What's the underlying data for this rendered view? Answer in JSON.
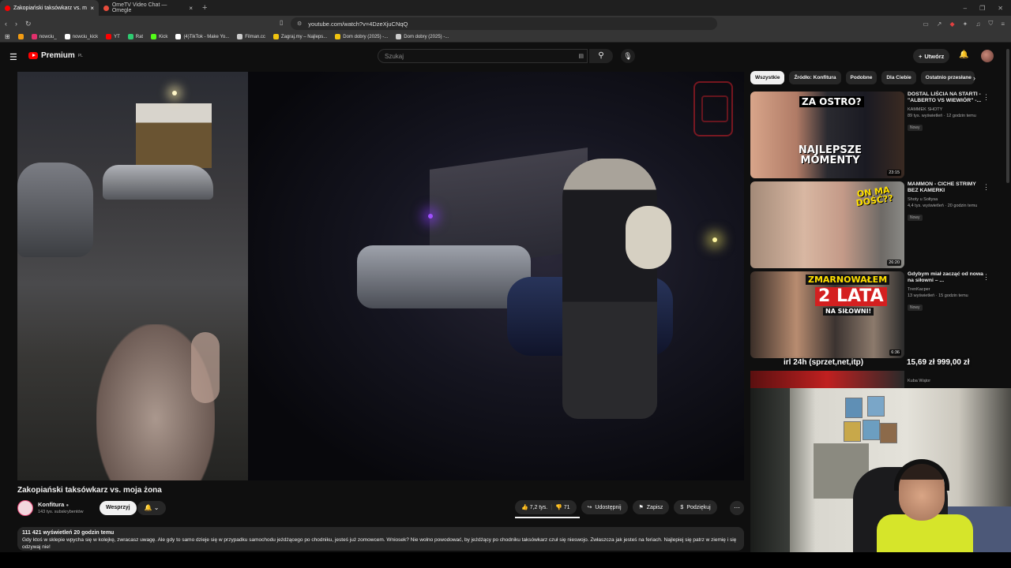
{
  "browser": {
    "tabs": [
      {
        "label": "Zakopiański taksówkarz vs. m",
        "active": true,
        "color": "#ff0000"
      },
      {
        "label": "OmeTV Video Chat — Omegle",
        "active": false,
        "color": "#e74c3c"
      }
    ],
    "url": "youtube.com/watch?v=4DzeXjuCNqQ",
    "bookmarks": [
      {
        "label": "nowciu_",
        "color": "#e1306c"
      },
      {
        "label": "nowciu_kick",
        "color": "#ffffff"
      },
      {
        "label": "YT",
        "color": "#ff0000"
      },
      {
        "label": "Rat",
        "color": "#2ecc71"
      },
      {
        "label": "Kick",
        "color": "#53fc18"
      },
      {
        "label": "(4)TikTok - Make Yo...",
        "color": "#ffffff"
      },
      {
        "label": "Filman.cc",
        "color": "#cccccc"
      },
      {
        "label": "Zagraj.my – Najleps...",
        "color": "#f1c40f"
      },
      {
        "label": "Dom dobry (2025) -...",
        "color": "#f1c40f"
      },
      {
        "label": "Dom dobry (2025) -...",
        "color": "#cccccc"
      }
    ]
  },
  "header": {
    "logo_text": "Premium",
    "logo_region": "PL",
    "search_placeholder": "Szukaj",
    "create_label": "Utwórz"
  },
  "video": {
    "title": "Zakopiański taksówkarz vs. moja żona",
    "channel_name": "Konfitura",
    "subscribers": "143 tys. subskrybentów",
    "support_label": "Wesprzyj",
    "likes": "7,2 tys.",
    "dislikes": "71",
    "share_label": "Udostępnij",
    "save_label": "Zapisz",
    "thanks_label": "Podziękuj",
    "views_meta": "111 421 wyświetleń  20 godzin temu",
    "description": "Gdy ktoś w sklepie wpycha się w kolejkę, zwracasz uwagę. Ale gdy to samo dzieje się w przypadku samochodu jeżdżącego po chodniku, jesteś już zomowcem. Wniosek? Nie wolno powodować, by jeżdżący po chodniku taksówkarz czuł się nieswojo. Zwłaszcza jak jesteś na feriach. Najlepiej się patrz w ziemię i się odzywaj nie!"
  },
  "chips": [
    "Wszystkie",
    "Źródło: Konfitura",
    "Podobne",
    "Dla Ciebie",
    "Ostatnio przesłane"
  ],
  "recommendations": [
    {
      "title": "DOSTAL LIŚCIA NA STARTI - \"ALBERTO VS WIEWIÓR\" -...",
      "channel": "KAMMEK SHOTY",
      "meta": "89 tys. wyświetleń · 12 godzin temu",
      "badge": "Nowy",
      "duration": "23:15",
      "thumb_text_1": "ZA OSTRO?",
      "thumb_text_2": "NAJLEPSZE MOMENTY"
    },
    {
      "title": "MAMMON - CICHE STRIMY BEZ KAMERKI",
      "channel": "Shoty u Sołtysa",
      "meta": "4,4 tys. wyświetleń · 20 godzin temu",
      "badge": "Nowy",
      "duration": "26:20",
      "thumb_text_1": "ON MA DOŚĆ??",
      "thumb_text_2": ""
    },
    {
      "title": "Gdybym miał zacząć od nowa na siłowni – ...",
      "channel": "TrenKacper",
      "meta": "13 wyświetleń · 15 godzin temu",
      "badge": "Nowy",
      "duration": "6:36",
      "thumb_text_1": "ZMARNOWAŁEM",
      "thumb_text_2": "2 LATA",
      "thumb_text_3": "NA SIŁOWNI!"
    }
  ],
  "partial_rec_channel": "Kuba Wątor",
  "overlay": {
    "left_text": "irl 24h (sprzet,net,itp)",
    "right_text": "15,69 zł  999,00 zł"
  }
}
